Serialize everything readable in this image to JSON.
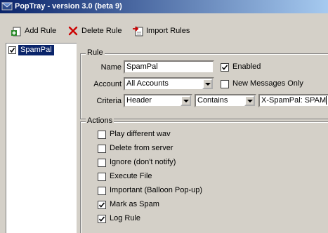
{
  "window": {
    "title": "PopTray - version 3.0 (beta 9)"
  },
  "toolbar": {
    "add_rule": "Add Rule",
    "delete_rule": "Delete Rule",
    "import_rules": "Import Rules"
  },
  "rules_list": [
    {
      "name": "SpamPal",
      "enabled": true,
      "selected": true
    }
  ],
  "rule": {
    "group_title": "Rule",
    "name_label": "Name",
    "name_value": "SpamPal",
    "enabled_label": "Enabled",
    "enabled": true,
    "account_label": "Account",
    "account_value": "All Accounts",
    "new_messages_only_label": "New Messages Only",
    "new_messages_only": false,
    "criteria_label": "Criteria",
    "criteria_field": "Header",
    "criteria_operator": "Contains",
    "criteria_text": "X-SpamPal: SPAM"
  },
  "actions": {
    "group_title": "Actions",
    "items": [
      {
        "label": "Play different wav",
        "checked": false
      },
      {
        "label": "Delete from server",
        "checked": false
      },
      {
        "label": "Ignore (don't notify)",
        "checked": false
      },
      {
        "label": "Execute File",
        "checked": false
      },
      {
        "label": "Important (Balloon Pop-up)",
        "checked": false
      },
      {
        "label": "Mark as Spam",
        "checked": true
      },
      {
        "label": "Log Rule",
        "checked": true
      }
    ]
  },
  "icons": {
    "app": "poptray-app-icon",
    "add_rule": "add-rule-icon",
    "delete_rule": "delete-rule-icon",
    "import_rules": "import-rules-icon"
  },
  "colors": {
    "window_bg": "#d4d0c8",
    "title_start": "#0a246a",
    "title_end": "#a6caf0",
    "selection": "#0a246a",
    "delete_red": "#cc0000"
  }
}
